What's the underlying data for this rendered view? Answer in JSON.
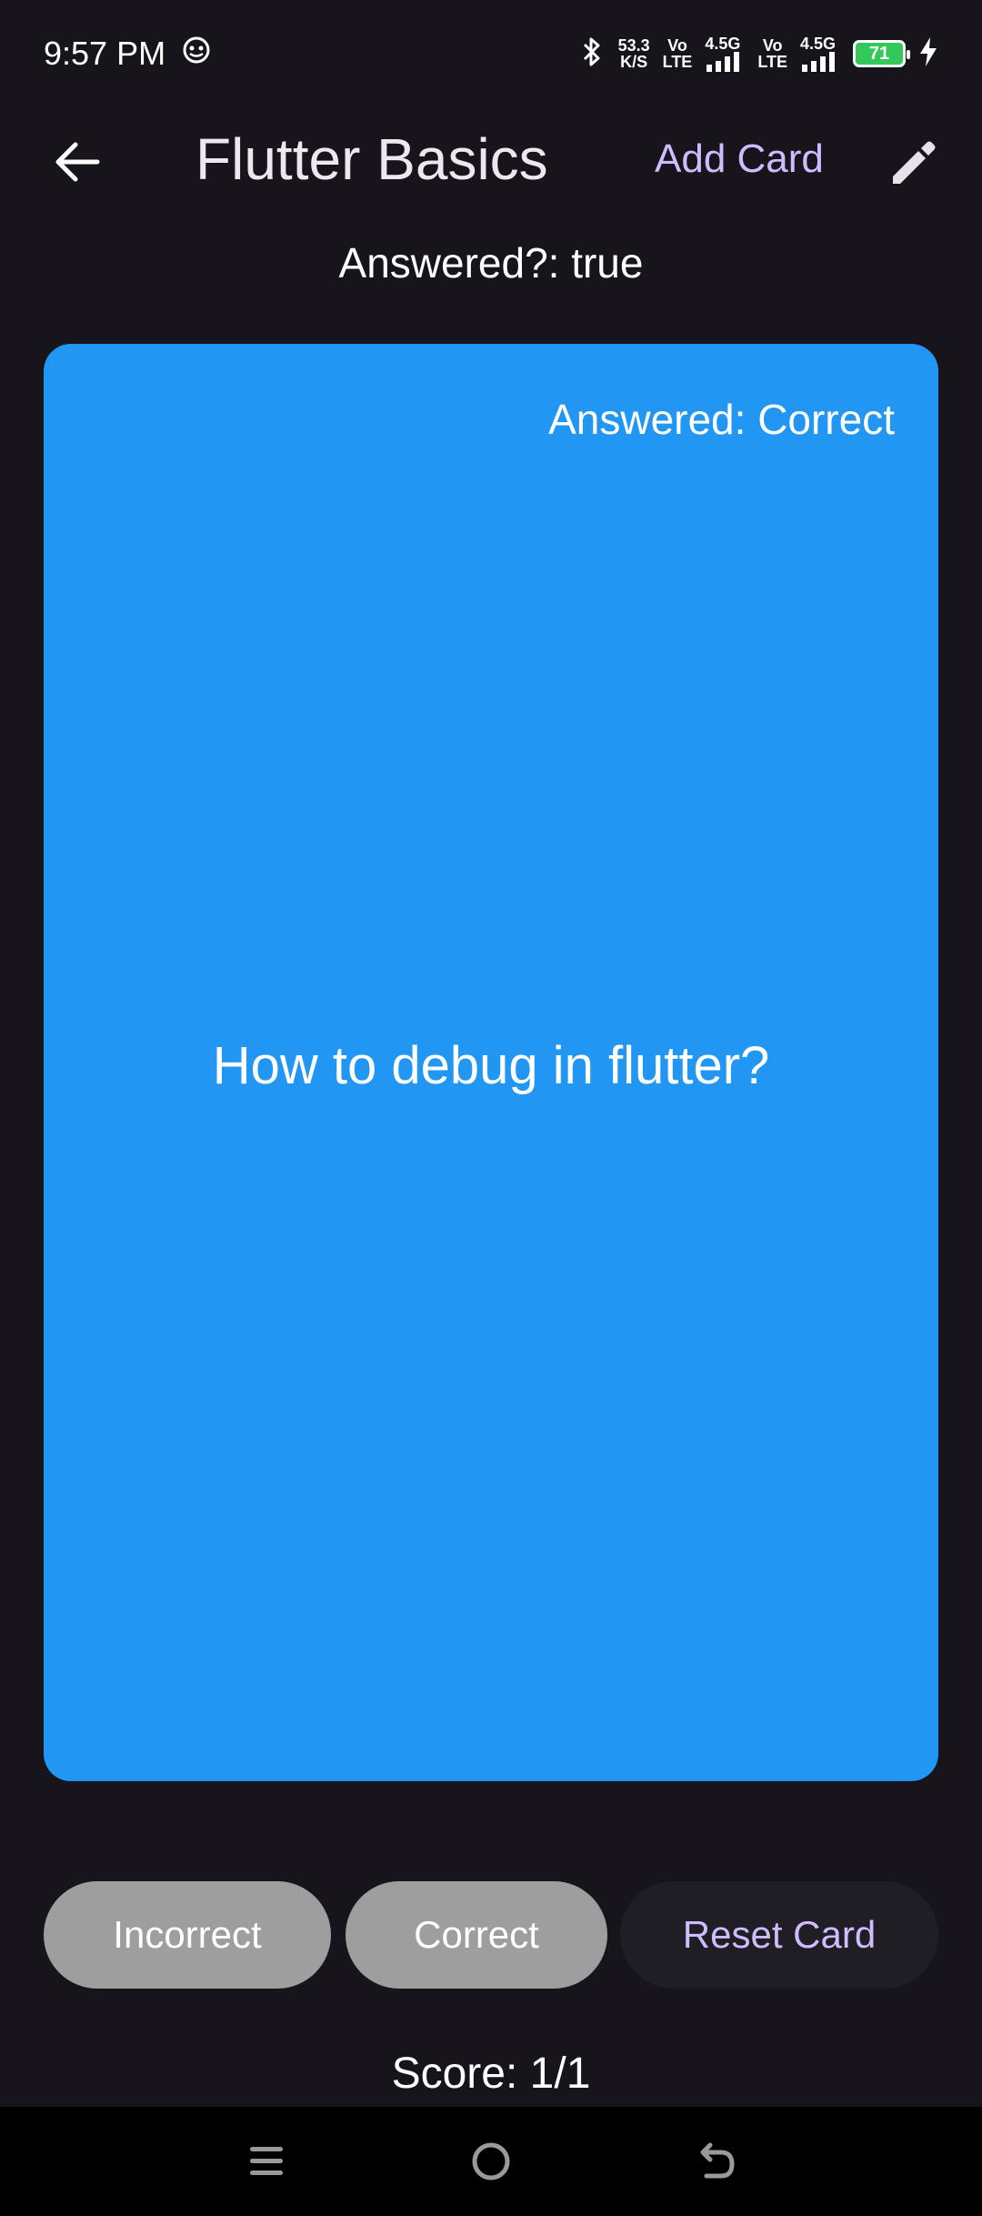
{
  "status_bar": {
    "time": "9:57 PM",
    "speed_value": "53.3",
    "speed_unit": "K/S",
    "net1_top": "Vo",
    "net1_bottom": "LTE",
    "net1_gen": "4.5G",
    "net2_top": "Vo",
    "net2_bottom": "LTE",
    "net2_gen": "4.5G",
    "battery": "71",
    "icons": [
      "notification-app-icon",
      "bluetooth-icon",
      "signal-icon",
      "signal-icon",
      "battery-icon",
      "charging-icon"
    ]
  },
  "app_bar": {
    "title": "Flutter Basics",
    "add_card_label": "Add Card",
    "icons": [
      "back-arrow-icon",
      "edit-pencil-icon"
    ]
  },
  "answered_flag": "Answered?: true",
  "card": {
    "status": "Answered: Correct",
    "question": "How to debug in flutter?",
    "color": "#2196f3"
  },
  "buttons": {
    "incorrect_label": "Incorrect",
    "correct_label": "Correct",
    "reset_label": "Reset Card"
  },
  "score": "Score: 1/1",
  "colors": {
    "background": "#17151b",
    "accent": "#cfbcff",
    "button_grey": "#9e9e9e"
  }
}
